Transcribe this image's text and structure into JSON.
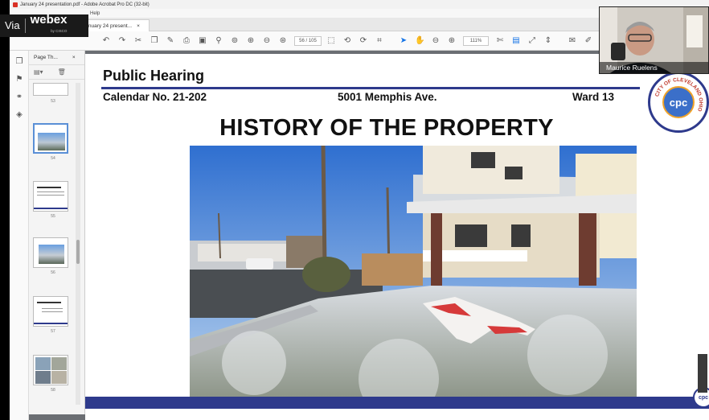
{
  "window": {
    "title": "January 24 presentation.pdf - Adobe Acrobat Pro DC (32-bit)",
    "menu_help": "Help",
    "tab_label": "January 24 present...",
    "tab_close": "×"
  },
  "toolbar": {
    "page_field": "56 / 105",
    "zoom_field": "111%"
  },
  "webex": {
    "via": "Via",
    "brand": "webex",
    "by": "by CISCO"
  },
  "thumbnail_panel": {
    "title": "Page Th...",
    "close": "×",
    "pages": [
      "53",
      "54",
      "55",
      "56",
      "57",
      "58"
    ]
  },
  "slide": {
    "header_title": "Public Hearing",
    "calendar": "Calendar No. 21-202",
    "address": "5001 Memphis Ave.",
    "ward": "Ward 13",
    "main_title": "HISTORY OF THE PROPERTY",
    "seal_text": "cpc",
    "seal_ring_text": "CITY OF CLEVELAND OHIO"
  },
  "video": {
    "participant_name": "Maurice Ruelens"
  },
  "colors": {
    "brand_navy": "#2e3a8c",
    "acrobat_red": "#d93025",
    "accent_blue": "#1473e6"
  }
}
